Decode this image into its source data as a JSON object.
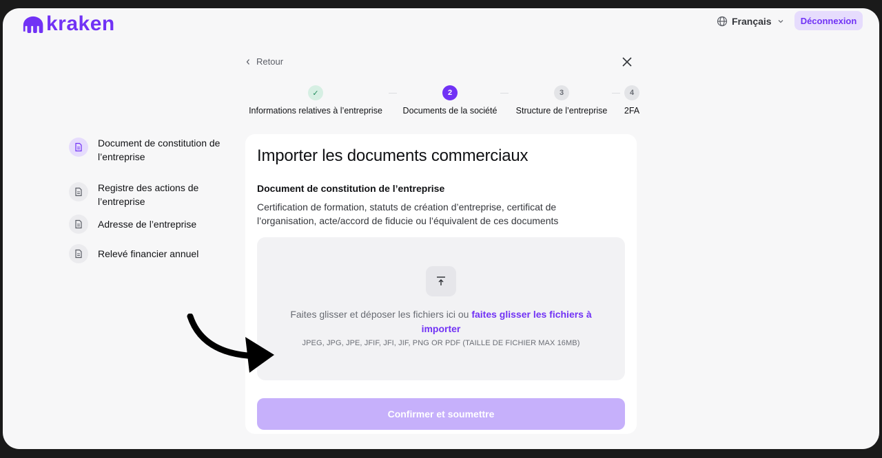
{
  "header": {
    "logo_text": "kraken",
    "language": "Français",
    "logout_label": "Déconnexion"
  },
  "nav": {
    "back_label": "Retour"
  },
  "steps": [
    {
      "number": "✓",
      "label": "Informations relatives à l’entreprise",
      "state": "done"
    },
    {
      "number": "2",
      "label": "Documents de la société",
      "state": "active"
    },
    {
      "number": "3",
      "label": "Structure de l’entreprise",
      "state": "todo"
    },
    {
      "number": "4",
      "label": "2FA",
      "state": "todo"
    }
  ],
  "sidebar": {
    "items": [
      {
        "label": "Document de constitution de l’entreprise",
        "active": true
      },
      {
        "label": "Registre des actions de l’entreprise",
        "active": false
      },
      {
        "label": "Adresse de l’entreprise",
        "active": false
      },
      {
        "label": "Relevé financier annuel",
        "active": false
      }
    ]
  },
  "card": {
    "title": "Importer les documents commerciaux",
    "subtitle": "Document de constitution de l’entreprise",
    "description": "Certification de formation, statuts de création d’entreprise, certificat de l’organisation, acte/accord de fiducie ou l’équivalent de ces documents",
    "dropzone": {
      "text": "Faites glisser et déposer les fichiers ici ou ",
      "link": "faites glisser les fichiers à importer",
      "formats": "JPEG, JPG, JPE, JFIF, JFI, JIF, PNG OR PDF (TAILLE DE FICHIER MAX 16MB)"
    },
    "submit_label": "Confirmer et soumettre"
  },
  "colors": {
    "brand": "#7132f5",
    "brand_light": "#e6dcfd",
    "submit_disabled": "#c6b0fb",
    "step_done": "#d6efe3"
  }
}
